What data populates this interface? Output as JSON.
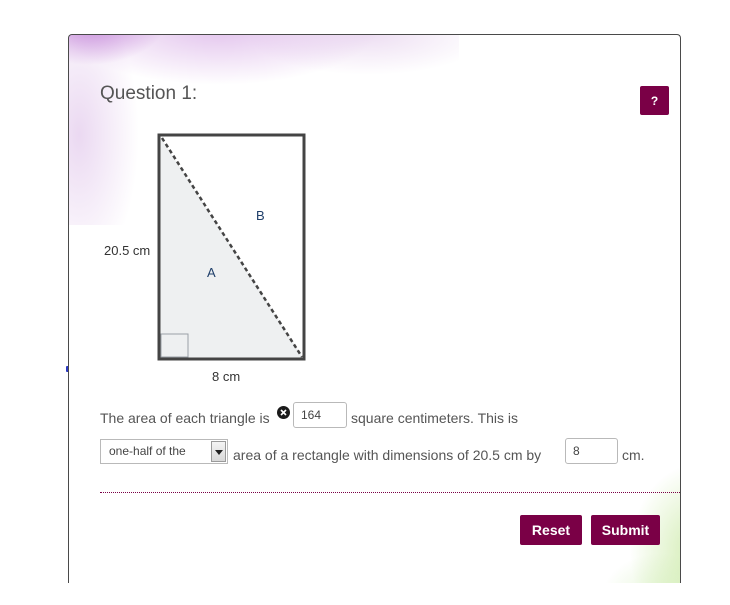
{
  "question": {
    "title": "Question 1:",
    "help_label": "?"
  },
  "figure": {
    "height_label": "20.5 cm",
    "width_label": "8 cm",
    "triangle_a": "A",
    "triangle_b": "B"
  },
  "sentence": {
    "part1": "The area of each triangle is",
    "area_value": "164",
    "part2": "square centimeters. This is",
    "dropdown_selected": "one-half of the",
    "part3": "area of a rectangle with dimensions of 20.5 cm by",
    "width_value": "8",
    "unit": "cm."
  },
  "buttons": {
    "reset": "Reset",
    "submit": "Submit"
  },
  "colors": {
    "accent": "#7a0046",
    "text": "#555555",
    "figure_text": "#1f3f6a",
    "triangle_fill": "#eef0f1"
  }
}
